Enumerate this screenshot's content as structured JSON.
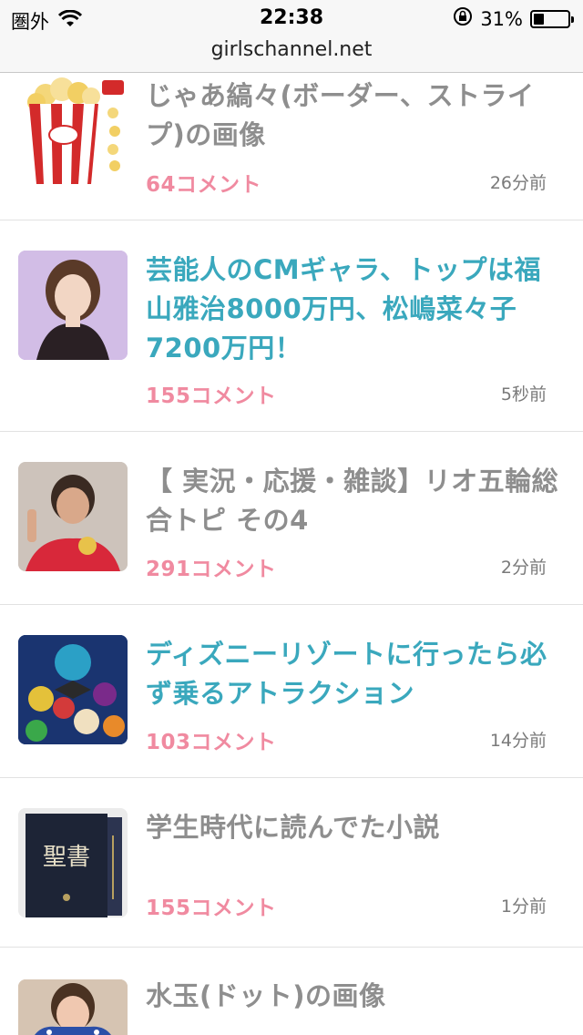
{
  "status": {
    "carrier": "圏外",
    "time": "22:38",
    "battery": "31%",
    "battery_level": 0.31
  },
  "address": "girlschannel.net",
  "items": [
    {
      "title": "じゃあ縞々(ボーダー、ストライプ)の画像",
      "comments": "64コメント",
      "time": "26分前",
      "style": "gray",
      "thumb": "popcorn"
    },
    {
      "title": "芸能人のCMギャラ、トップは福山雅治8000万円、松嶋菜々子7200万円！",
      "comments": "155コメント",
      "time": "5秒前",
      "style": "teal",
      "thumb": "woman-portrait"
    },
    {
      "title": "【 実況・応援・雑談】リオ五輪総合トピ その4",
      "comments": "291コメント",
      "time": "2分前",
      "style": "gray",
      "thumb": "athlete-medal"
    },
    {
      "title": "ディズニーリゾートに行ったら必ず乗るアトラクション",
      "comments": "103コメント",
      "time": "14分前",
      "style": "teal",
      "thumb": "disney-characters"
    },
    {
      "title": "学生時代に読んでた小説",
      "comments": "155コメント",
      "time": "1分前",
      "style": "gray",
      "thumb": "book",
      "book_text": "聖書"
    },
    {
      "title": "水玉(ドット)の画像",
      "comments": "",
      "time": "",
      "style": "gray",
      "thumb": "polka-dot-woman"
    }
  ]
}
